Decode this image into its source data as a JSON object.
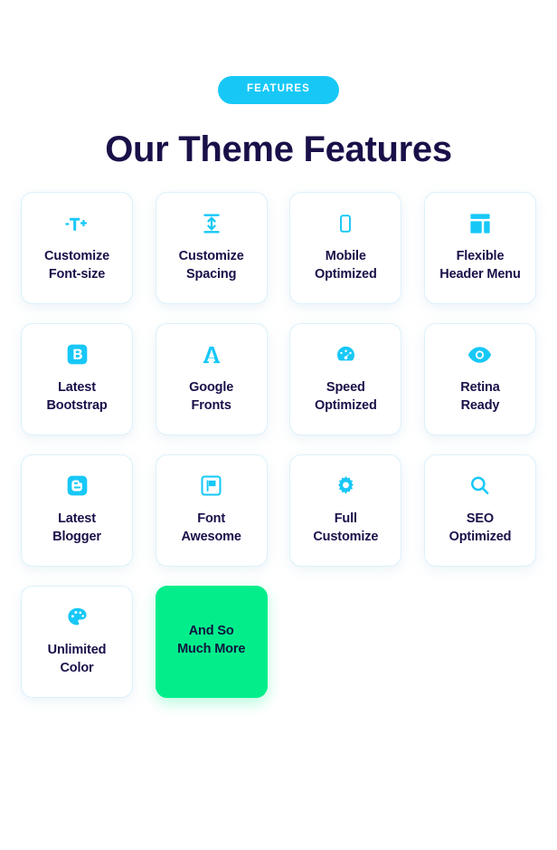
{
  "header": {
    "badge_label": "FEATURES",
    "title": "Our Theme Features"
  },
  "colors": {
    "accent_cyan": "#17C8F7",
    "heading_navy": "#1A1049",
    "highlight_green": "#03EE8B",
    "card_border": "#DCF1FB",
    "card_background": "#FFFFFF",
    "page_background": "#FFFFFF"
  },
  "features": [
    {
      "label": "Customize\nFont-size",
      "icon": "text-height-icon",
      "highlight": false
    },
    {
      "label": "Customize\nSpacing",
      "icon": "arrows-vertical-icon",
      "highlight": false
    },
    {
      "label": "Mobile\nOptimized",
      "icon": "mobile-phone-icon",
      "highlight": false
    },
    {
      "label": "Flexible\nHeader Menu",
      "icon": "layout-grid-icon",
      "highlight": false
    },
    {
      "label": "Latest\nBootstrap",
      "icon": "bootstrap-logo-icon",
      "highlight": false
    },
    {
      "label": "Google\nFronts",
      "icon": "font-letter-a-icon",
      "highlight": false
    },
    {
      "label": "Speed\nOptimized",
      "icon": "speedometer-icon",
      "highlight": false
    },
    {
      "label": "Retina\nReady",
      "icon": "eye-icon",
      "highlight": false
    },
    {
      "label": "Latest\nBlogger",
      "icon": "blogger-logo-icon",
      "highlight": false
    },
    {
      "label": "Font\nAwesome",
      "icon": "font-awesome-flag-icon",
      "highlight": false
    },
    {
      "label": "Full\nCustomize",
      "icon": "gear-icon",
      "highlight": false
    },
    {
      "label": "SEO\nOptimized",
      "icon": "magnifier-icon",
      "highlight": false
    },
    {
      "label": "Unlimited\nColor",
      "icon": "palette-icon",
      "highlight": false
    },
    {
      "label": "And So\nMuch More",
      "icon": "none",
      "highlight": true
    }
  ]
}
